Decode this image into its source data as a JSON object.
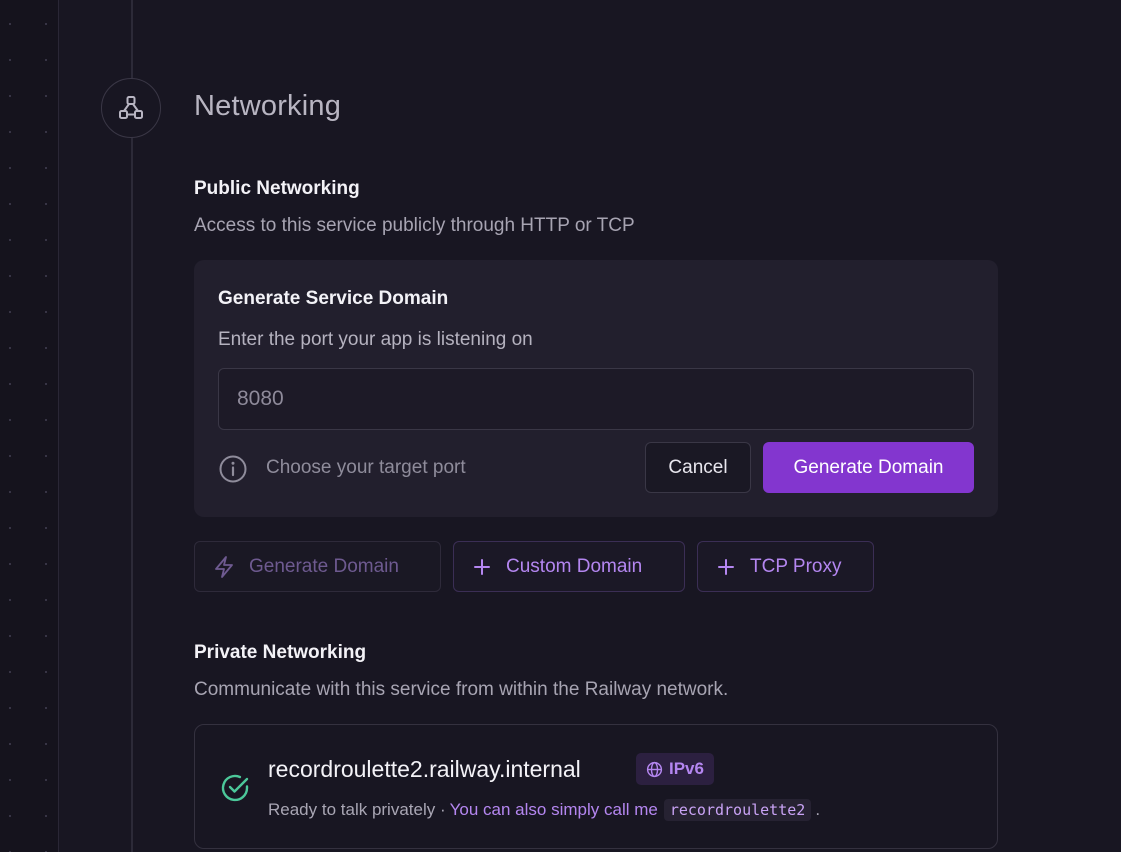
{
  "section": {
    "title": "Networking",
    "icon": "network-nodes-icon"
  },
  "public": {
    "heading": "Public Networking",
    "description": "Access to this service publicly through HTTP or TCP",
    "card": {
      "title": "Generate Service Domain",
      "label": "Enter the port your app is listening on",
      "port_placeholder": "8080",
      "port_value": "",
      "hint": "Choose your target port",
      "cancel_label": "Cancel",
      "generate_label": "Generate Domain"
    },
    "actions": [
      {
        "label": "Generate Domain",
        "icon": "lightning-icon",
        "disabled": true
      },
      {
        "label": "Custom Domain",
        "icon": "plus-icon",
        "disabled": false
      },
      {
        "label": "TCP Proxy",
        "icon": "plus-icon",
        "disabled": false
      }
    ]
  },
  "private": {
    "heading": "Private Networking",
    "description": "Communicate with this service from within the Railway network.",
    "hostname": "recordroulette2.railway.internal",
    "badge": "IPv6",
    "status": "Ready to talk privately ·",
    "alias_text": "You can also simply call me",
    "alias_code": "recordroulette2",
    "trailing": "."
  },
  "colors": {
    "accent": "#8336cf",
    "accent_text": "#b486f0",
    "success": "#4cc89a",
    "background": "#181622",
    "card": "#221f2d"
  }
}
